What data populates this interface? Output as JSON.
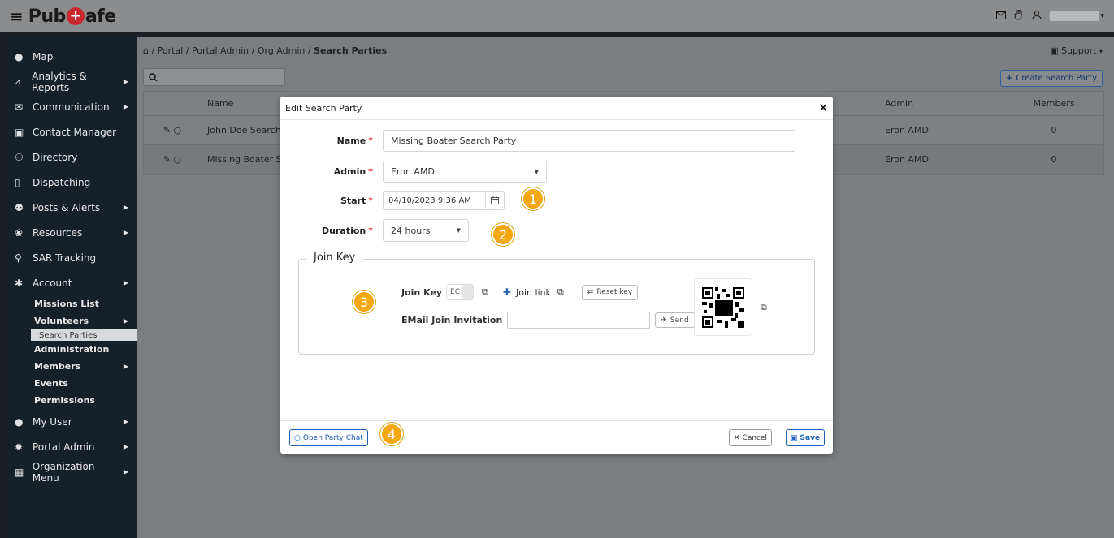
{
  "topbar": {
    "logo_left": "Pub",
    "logo_plus": "+",
    "logo_right": "afe",
    "user_caret": "▾"
  },
  "sidebar": {
    "items": [
      {
        "label": "Map"
      },
      {
        "label": "Analytics & Reports"
      },
      {
        "label": "Communication"
      },
      {
        "label": "Contact Manager"
      },
      {
        "label": "Directory"
      },
      {
        "label": "Dispatching"
      },
      {
        "label": "Posts & Alerts"
      },
      {
        "label": "Resources"
      },
      {
        "label": "SAR Tracking"
      },
      {
        "label": "Account"
      }
    ],
    "sub_items": [
      {
        "label": "Missions List"
      },
      {
        "label": "Volunteers"
      },
      {
        "label": "Search Parties"
      },
      {
        "label": "Administration"
      },
      {
        "label": "Members"
      },
      {
        "label": "Events"
      },
      {
        "label": "Permissions"
      }
    ],
    "items_after": [
      {
        "label": "My User"
      },
      {
        "label": "Portal Admin"
      },
      {
        "label": "Organization Menu"
      }
    ]
  },
  "breadcrumb": {
    "path": "/ Portal / Portal Admin / Org Admin /",
    "current": "Search Parties"
  },
  "support_label": "Support",
  "create_button": "Create Search Party",
  "table": {
    "headers": {
      "name": "Name",
      "admin": "Admin",
      "members": "Members"
    },
    "rows": [
      {
        "name": "John Doe Search P",
        "admin": "Eron AMD",
        "members": "0"
      },
      {
        "name": "Missing Boater Se",
        "admin": "Eron AMD",
        "members": "0"
      }
    ]
  },
  "modal": {
    "title": "Edit Search Party",
    "close": "×",
    "name_label": "Name",
    "name_value": "Missing Boater Search Party",
    "admin_label": "Admin",
    "admin_value": "Eron AMD",
    "start_label": "Start",
    "start_value": "04/10/2023 9:36 AM",
    "duration_label": "Duration",
    "duration_value": "24 hours",
    "join_key_legend": "Join Key",
    "join_key_label": "Join Key",
    "join_key_value": "EC",
    "join_link_label": "Join link",
    "reset_key_label": "Reset key",
    "email_invite_label": "EMail Join Invitation",
    "send_label": "Send",
    "open_chat_label": "Open Party Chat",
    "cancel_label": "Cancel",
    "save_label": "Save",
    "required_mark": "*"
  },
  "badges": [
    "1",
    "2",
    "3",
    "4"
  ],
  "colors": {
    "accent": "#1f5fb4",
    "badge": "#f3a712",
    "sidebar_bg": "#152129",
    "required": "#d33333"
  }
}
